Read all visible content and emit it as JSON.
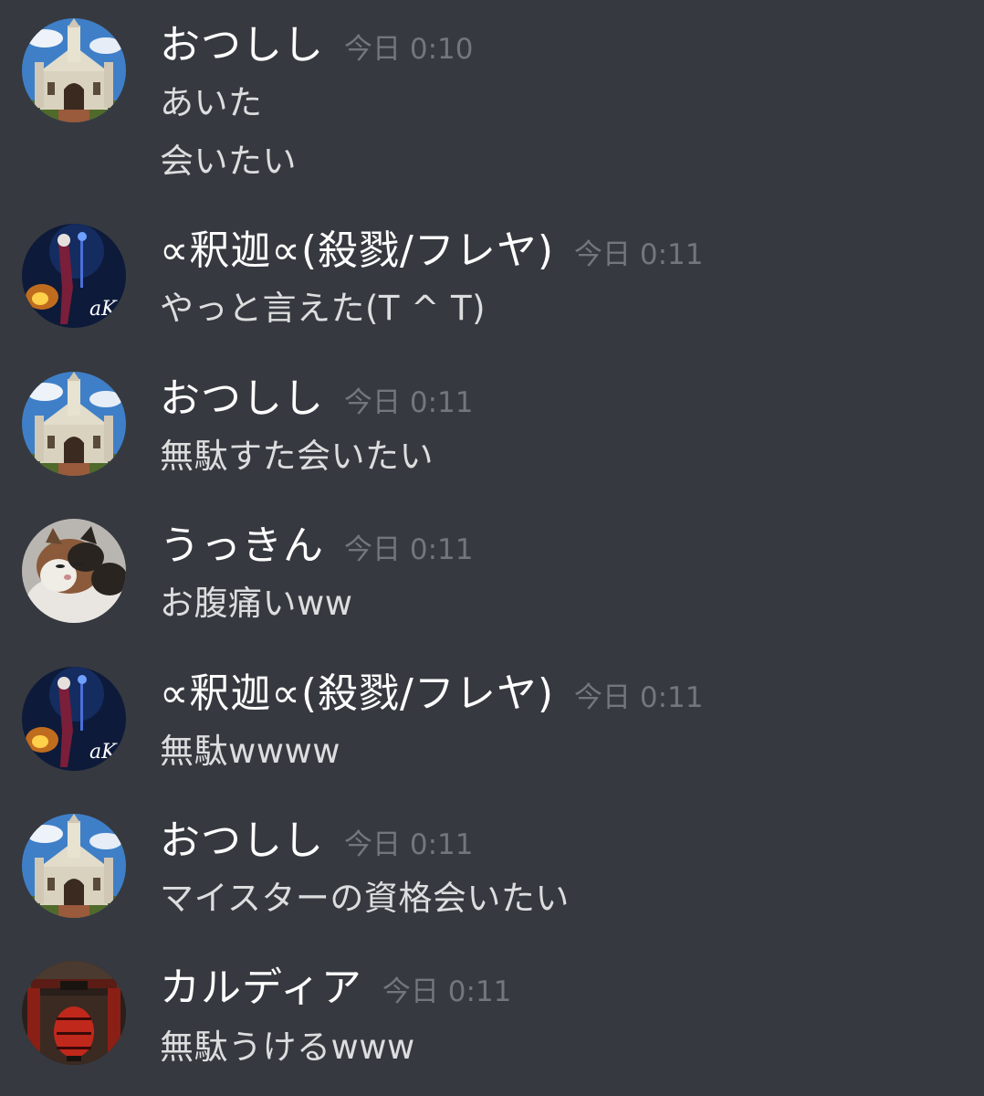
{
  "messages": [
    {
      "author": "おつしし",
      "avatar": "church-avatar",
      "time": "今日 0:10",
      "lines": [
        "あいた",
        "会いたい"
      ]
    },
    {
      "author": "∝釈迦∝(殺戮/フレヤ)",
      "avatar": "dark-fantasy-avatar",
      "time": "今日 0:11",
      "lines": [
        "やっと言えた(T ^ T)"
      ]
    },
    {
      "author": "おつしし",
      "avatar": "church-avatar",
      "time": "今日 0:11",
      "lines": [
        "無駄すた会いたい"
      ]
    },
    {
      "author": "うっきん",
      "avatar": "cat-avatar",
      "time": "今日 0:11",
      "lines": [
        "お腹痛いww"
      ]
    },
    {
      "author": "∝釈迦∝(殺戮/フレヤ)",
      "avatar": "dark-fantasy-avatar",
      "time": "今日 0:11",
      "lines": [
        "無駄wwww"
      ]
    },
    {
      "author": "おつしし",
      "avatar": "church-avatar",
      "time": "今日 0:11",
      "lines": [
        "マイスターの資格会いたい"
      ]
    },
    {
      "author": "カルディア",
      "avatar": "temple-gate-avatar",
      "time": "今日 0:11",
      "lines": [
        "無駄うけるwww"
      ]
    }
  ]
}
